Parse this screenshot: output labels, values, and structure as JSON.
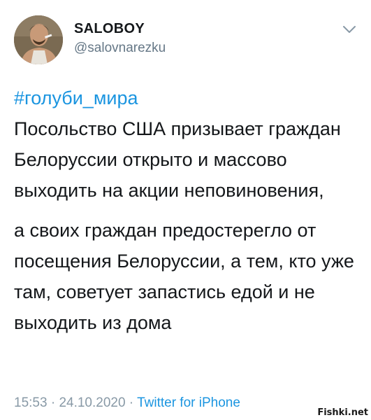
{
  "author": {
    "display_name": "SALOBOY",
    "handle": "@salovnarezku"
  },
  "tweet": {
    "hashtag": "#голуби_мира",
    "paragraph_1": "Посольство США призывает граждан Белоруссии открыто и массово выходить на акции неповиновения,",
    "paragraph_2": "а своих граждан предостерегло от посещения Белоруссии, а тем, кто уже там, советует запастись едой и не выходить из дома"
  },
  "meta": {
    "time": "15:53",
    "separator_1": " · ",
    "date": "24.10.2020",
    "separator_2": " · ",
    "source": "Twitter for iPhone"
  },
  "watermark": "Fishki.net",
  "icons": {
    "menu": "chevron-down-icon"
  },
  "colors": {
    "link": "#1b95e0",
    "secondary_text": "#657786",
    "meta_text": "#8899a6",
    "primary_text": "#14171a"
  }
}
